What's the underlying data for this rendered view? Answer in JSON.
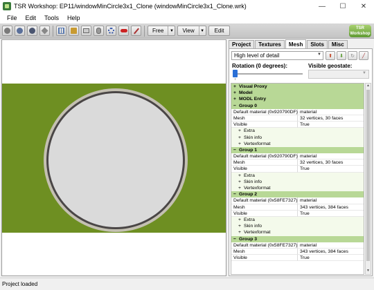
{
  "window": {
    "title": "TSR Workshop: EP11/windowMinCircle3x1_Clone (windowMinCircle3x1_Clone.wrk)",
    "min_glyph": "—",
    "max_glyph": "☐",
    "close_glyph": "✕"
  },
  "menu": [
    "File",
    "Edit",
    "Tools",
    "Help"
  ],
  "toolbar": {
    "camera_mode": "Free",
    "view_label": "View",
    "edit_label": "Edit",
    "logo_line1": "TSR",
    "logo_line2": "Workshop"
  },
  "viewport": {
    "colors": {
      "grass": "#6e8f22",
      "frame": "#c4c0b2",
      "rim": "#4a4646",
      "glass": "#dadada"
    }
  },
  "panel": {
    "tabs": [
      "Project",
      "Textures",
      "Mesh",
      "Slots",
      "Misc"
    ],
    "active_tab": "Mesh",
    "lod_value": "High level of detail",
    "rotation_label": "Rotation (0 degrees):",
    "rotation_value": 0,
    "geostate_label": "Visible geostate:",
    "geostate_value": ""
  },
  "tree": {
    "rows": [
      {
        "type": "sec",
        "pm": "+",
        "label": "Visual Proxy"
      },
      {
        "type": "sec",
        "pm": "+",
        "label": "Model"
      },
      {
        "type": "sec",
        "pm": "+",
        "label": "MODL Entry"
      },
      {
        "type": "sec",
        "pm": "−",
        "label": "Group 0"
      },
      {
        "type": "prop",
        "key": "Default material (0x920790DF)",
        "value": "material"
      },
      {
        "type": "prop",
        "key": "Mesh",
        "value": "32 vertices, 30 faces"
      },
      {
        "type": "prop",
        "key": "Visible",
        "value": "True"
      },
      {
        "type": "sub",
        "pm": "+",
        "label": "Extra"
      },
      {
        "type": "sub",
        "pm": "+",
        "label": "Skin info"
      },
      {
        "type": "sub",
        "pm": "+",
        "label": "Vertexformat"
      },
      {
        "type": "sec",
        "pm": "−",
        "label": "Group 1"
      },
      {
        "type": "prop",
        "key": "Default material (0x920790DF)",
        "value": "material"
      },
      {
        "type": "prop",
        "key": "Mesh",
        "value": "32 vertices, 30 faces"
      },
      {
        "type": "prop",
        "key": "Visible",
        "value": "True"
      },
      {
        "type": "sub",
        "pm": "+",
        "label": "Extra"
      },
      {
        "type": "sub",
        "pm": "+",
        "label": "Skin info"
      },
      {
        "type": "sub",
        "pm": "+",
        "label": "Vertexformat"
      },
      {
        "type": "sec",
        "pm": "−",
        "label": "Group 2"
      },
      {
        "type": "prop",
        "key": "Default material (0x58FE7327)",
        "value": "material"
      },
      {
        "type": "prop",
        "key": "Mesh",
        "value": "343 vertices, 384 faces"
      },
      {
        "type": "prop",
        "key": "Visible",
        "value": "True"
      },
      {
        "type": "sub",
        "pm": "+",
        "label": "Extra"
      },
      {
        "type": "sub",
        "pm": "+",
        "label": "Skin info"
      },
      {
        "type": "sub",
        "pm": "+",
        "label": "Vertexformat"
      },
      {
        "type": "sec",
        "pm": "−",
        "label": "Group 3"
      },
      {
        "type": "prop",
        "key": "Default material (0x58FE7327)",
        "value": "material"
      },
      {
        "type": "prop",
        "key": "Mesh",
        "value": "343 vertices, 384 faces"
      },
      {
        "type": "prop",
        "key": "Visible",
        "value": "True"
      }
    ]
  },
  "status": {
    "text": "Project loaded"
  }
}
